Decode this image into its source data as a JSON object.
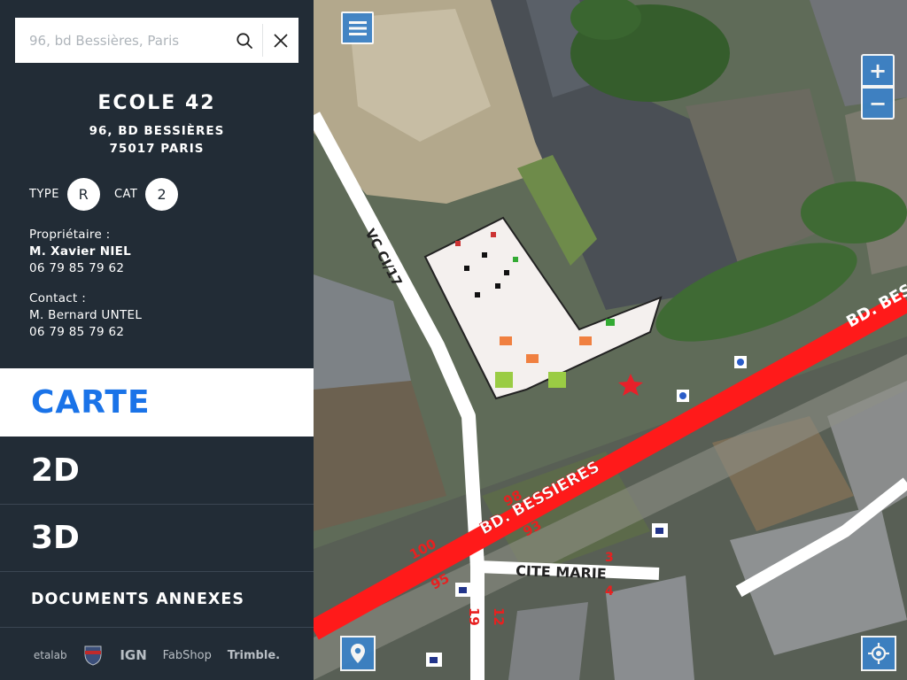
{
  "search": {
    "placeholder": "96, bd Bessières, Paris",
    "value": ""
  },
  "school": {
    "name": "ECOLE 42",
    "address_line1": "96, BD BESSIÈRES",
    "address_line2": "75017 PARIS",
    "type_label": "TYPE",
    "type_value": "R",
    "cat_label": "CAT",
    "cat_value": "2"
  },
  "owner": {
    "label": "Propriétaire :",
    "name": "M. Xavier NIEL",
    "phone": "06 79 85 79 62"
  },
  "contact": {
    "label": "Contact :",
    "name": "M. Bernard UNTEL",
    "phone": "06 79 85 79 62"
  },
  "menu": [
    {
      "label": "CARTE",
      "active": true
    },
    {
      "label": "2D",
      "active": false
    },
    {
      "label": "3D",
      "active": false
    },
    {
      "label": "DOCUMENTS ANNEXES",
      "active": false
    }
  ],
  "partners": [
    "etalab",
    "IGN",
    "FabShop",
    "Trimble."
  ],
  "map": {
    "labels": {
      "road_main": "BD. BESSIERES",
      "road_main_right": "BD. BESS",
      "road_side": "VC CI/17",
      "cite": "CITE MARIE",
      "num_98": "98",
      "num_93": "93",
      "num_100": "100",
      "num_95": "95",
      "num_19": "19",
      "num_12": "12",
      "num_3": "3",
      "num_4": "4"
    },
    "zoom_in": "+",
    "zoom_out": "−"
  },
  "colors": {
    "accent": "#1a73e8",
    "sidebar_bg": "#222c36",
    "map_button": "#3a82c8",
    "road": "#ff1a1a",
    "marker": "#e8202a"
  }
}
